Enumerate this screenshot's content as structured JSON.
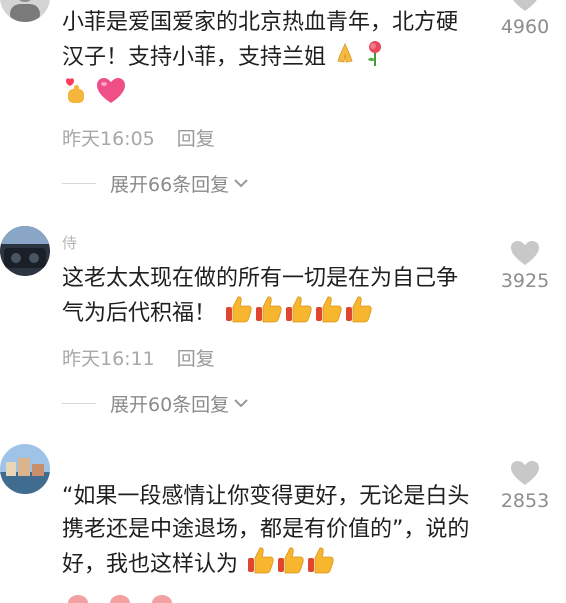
{
  "comments": [
    {
      "username": "",
      "text": "小菲是爱国爱家的北京热血青年，北方硬汉子！支持小菲，支持兰姐",
      "emojis": [
        "praying-hands",
        "rose",
        "finger-heart",
        "pink-heart"
      ],
      "time": "昨天16:05",
      "reply": "回复",
      "expand": "展开66条回复",
      "likes": "4960"
    },
    {
      "username": "侍",
      "text": "这老太太现在做的所有一切是在为自己争气为后代积福！",
      "emojis": [
        "thumbs-up",
        "thumbs-up",
        "thumbs-up",
        "thumbs-up",
        "thumbs-up"
      ],
      "time": "昨天16:11",
      "reply": "回复",
      "expand": "展开60条回复",
      "likes": "3925"
    },
    {
      "username": "",
      "text": "“如果一段感情让你变得更好，无论是白头携老还是中途退场，都是有价值的”，说的好，我也这样认为",
      "emojis": [
        "thumbs-up",
        "thumbs-up",
        "thumbs-up"
      ],
      "time": "",
      "reply": "",
      "expand": "",
      "likes": "2853"
    }
  ],
  "colors": {
    "heart_gray": "#c8c8c8",
    "text": "#1f1f1f",
    "meta": "#a8a8a8"
  }
}
